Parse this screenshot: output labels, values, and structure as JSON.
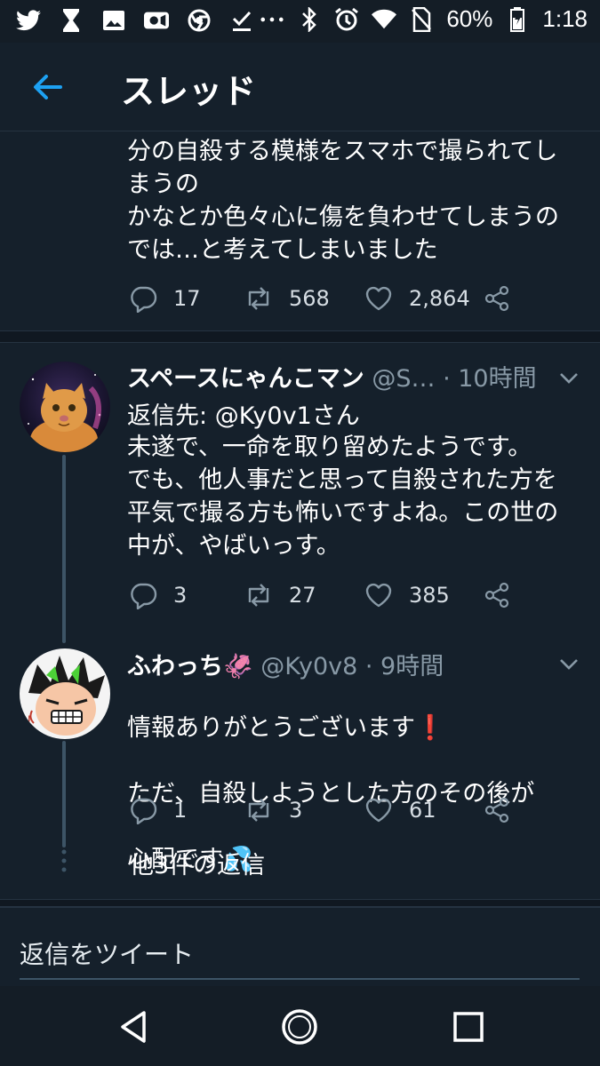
{
  "status_bar": {
    "battery_percent": "60%",
    "time": "1:18",
    "icons": [
      "twitter-icon",
      "hourglass-icon",
      "image-icon",
      "video-icon",
      "chrome-icon",
      "download-done-icon",
      "more-icon",
      "bluetooth-icon",
      "alarm-icon",
      "wifi-icon",
      "no-sim-icon",
      "battery-icon"
    ]
  },
  "header": {
    "title": "スレッド"
  },
  "tail_tweet": {
    "text": "分の自殺する模様をスマホで撮られてし\nまうの\nかなとか色々心に傷を負わせてしまうの\nでは…と考えてしまいました",
    "replies": "17",
    "retweets": "568",
    "likes": "2,864"
  },
  "tweets": [
    {
      "name": "スペースにゃんこマン",
      "handle": "@S…",
      "time": "· 10時間",
      "reply_to_label": "返信先: ",
      "reply_to_mention": "@Ky0v1さん",
      "text": "未遂で、一命を取り留めたようです。\nでも、他人事だと思って自殺された方を\n平気で撮る方も怖いですよね。この世の\n中が、やばいっす。",
      "replies": "3",
      "retweets": "27",
      "likes": "385"
    },
    {
      "name": "ふわっち",
      "name_emoji": "🦑",
      "handle": "@Ky0v8 · 9時間",
      "text_line1": "情報ありがとうございます",
      "text_line1_emoji": "❗",
      "text_line2": "ただ、自殺しようとした方のその後が",
      "text_line3": "心配です",
      "text_line3_emoji": "💦",
      "replies": "1",
      "retweets": "3",
      "likes": "61"
    }
  ],
  "more_replies": "他3件の返信",
  "reply_box": {
    "placeholder": "返信をツイート"
  },
  "colors": {
    "background": "#15202b",
    "accent": "#1da1f2",
    "muted": "#8899a6"
  }
}
